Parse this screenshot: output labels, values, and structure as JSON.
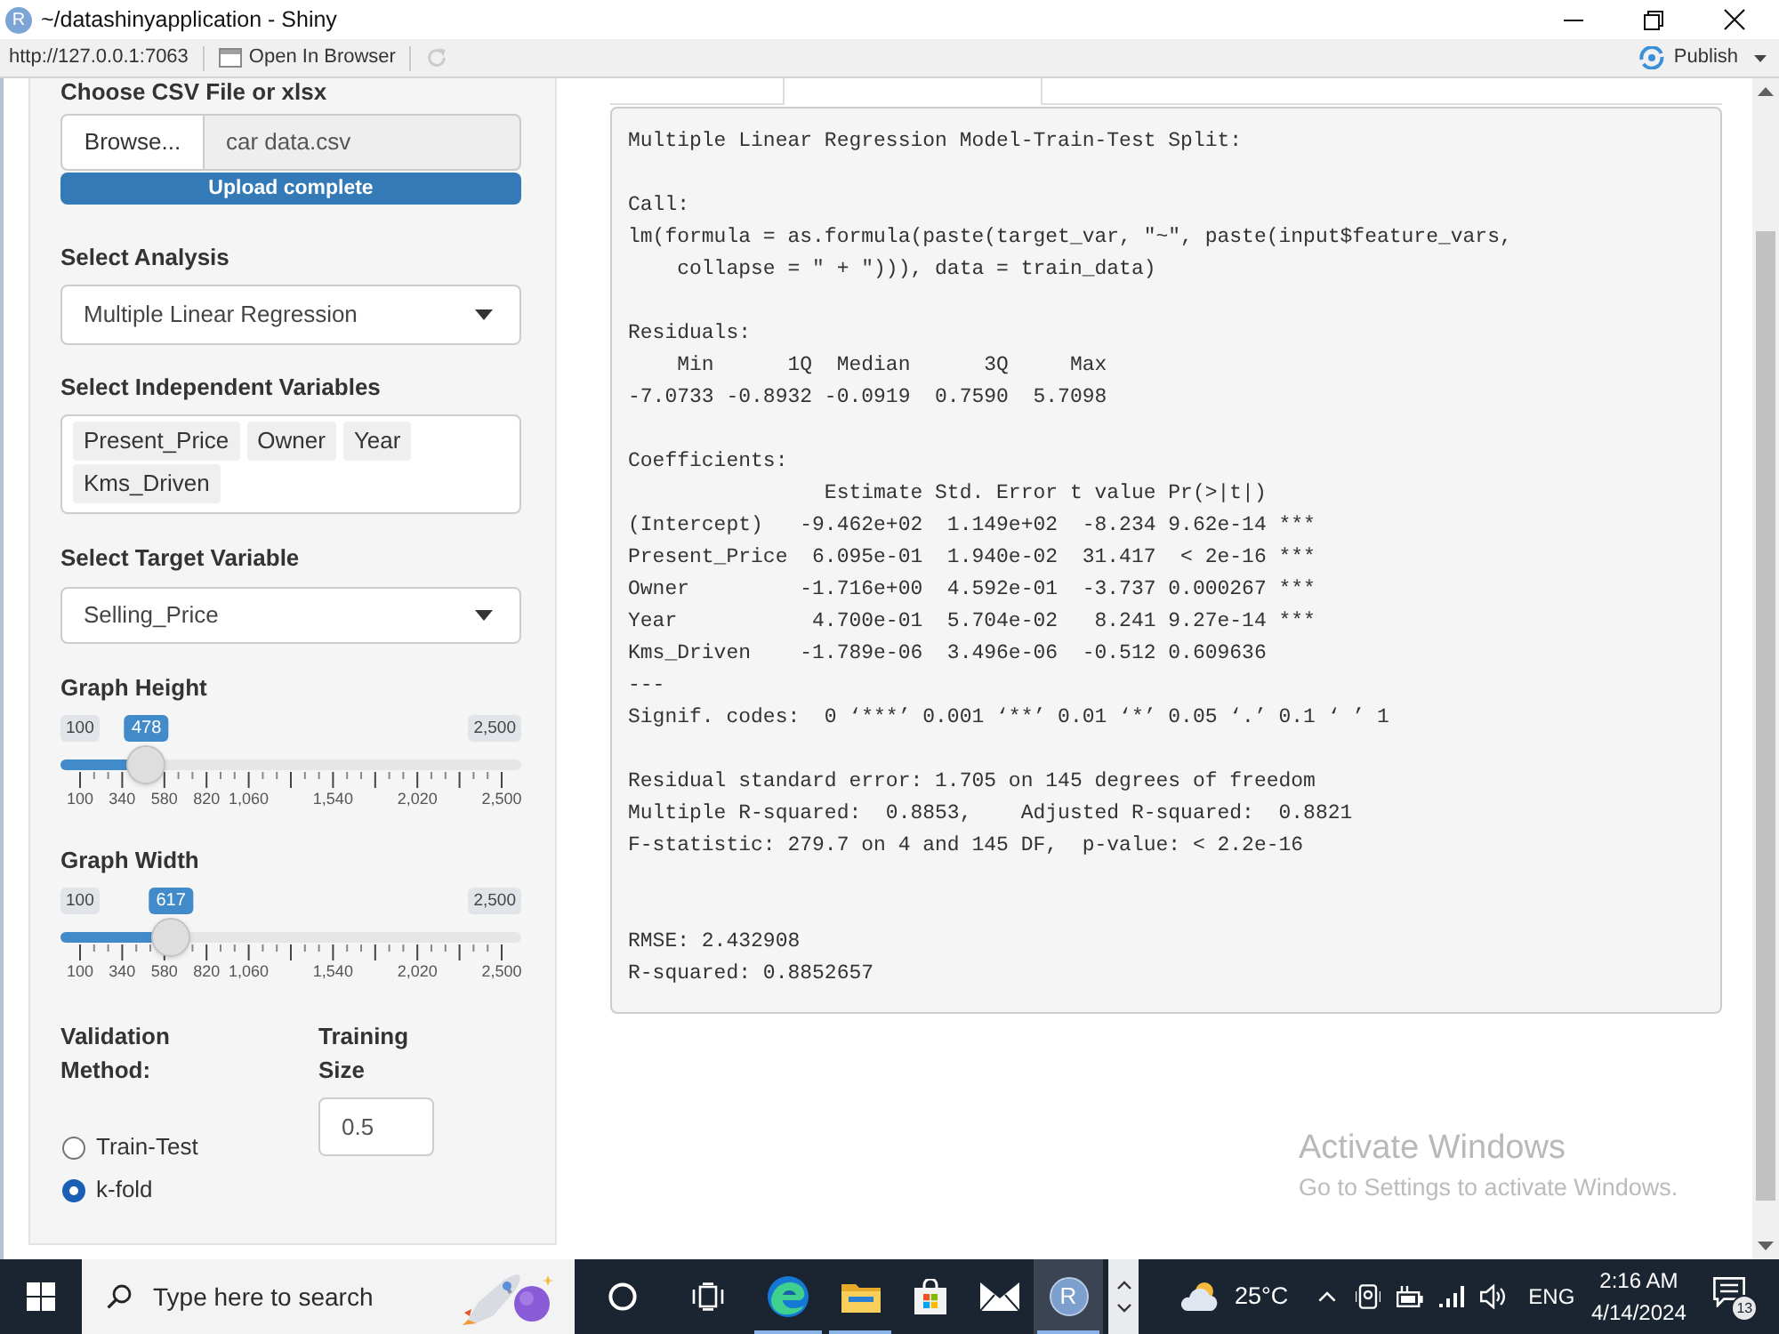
{
  "window": {
    "logo_letter": "R",
    "title": "~/datashinyapplication - Shiny"
  },
  "toolbar": {
    "url": "http://127.0.0.1:7063",
    "open_button": "Open In Browser",
    "publish_button": "Publish"
  },
  "sidebar": {
    "file_input": {
      "label": "Choose CSV File or xlsx",
      "browse_button": "Browse...",
      "file_name": "car data.csv",
      "progress": {
        "text": "Upload complete",
        "level": 1
      }
    },
    "analysis_select": {
      "label": "Select Analysis",
      "value": "Multiple Linear Regression"
    },
    "variables_select": {
      "label": "Select Independent Variables",
      "chips": [
        "Present_Price",
        "Owner",
        "Year",
        "Kms_Driven"
      ]
    },
    "target_select": {
      "label": "Select Target Variable",
      "value": "Selling_Price"
    },
    "sliders": [
      {
        "label": "Graph Height",
        "min": "100",
        "max": "2,500",
        "value": "478",
        "level": 0.1575,
        "grid": [
          "100",
          "340",
          "580",
          "820",
          "1,060",
          "1,540",
          "2,020",
          "2,500"
        ]
      },
      {
        "label": "Graph Width",
        "min": "100",
        "max": "2,500",
        "value": "617",
        "level": 0.2154,
        "grid": [
          "100",
          "340",
          "580",
          "820",
          "1,060",
          "1,540",
          "2,020",
          "2,500"
        ]
      }
    ],
    "validation": {
      "label": "Validation Method:",
      "options": [
        {
          "label": "Train-Test",
          "selected": false
        },
        {
          "label": "k-fold",
          "selected": true
        }
      ]
    },
    "training_size": {
      "label": "Training Size",
      "value": "0.5"
    }
  },
  "output": {
    "blocks": [
      [
        "Multiple Linear Regression Model-Train-Test Split:"
      ],
      [
        "Call:",
        "lm(formula = as.formula(paste(target_var, \"~\", paste(input$feature_vars,",
        "    collapse = \" + \"))), data = train_data)"
      ],
      [
        "Residuals:",
        "    Min      1Q  Median      3Q     Max",
        "-7.0733 -0.8932 -0.0919  0.7590  5.7098"
      ],
      [
        "Coefficients:",
        "                Estimate Std. Error t value Pr(>|t|)",
        "(Intercept)   -9.462e+02  1.149e+02  -8.234 9.62e-14 ***",
        "Present_Price  6.095e-01  1.940e-02  31.417  < 2e-16 ***",
        "Owner         -1.716e+00  4.592e-01  -3.737 0.000267 ***",
        "Year           4.700e-01  5.704e-02   8.241 9.27e-14 ***",
        "Kms_Driven    -1.789e-06  3.496e-06  -0.512 0.609636",
        "---",
        "Signif. codes:  0 ‘***’ 0.001 ‘**’ 0.01 ‘*’ 0.05 ‘.’ 0.1 ‘ ’ 1"
      ],
      [
        "Residual standard error: 1.705 on 145 degrees of freedom",
        "Multiple R-squared:  0.8853,    Adjusted R-squared:  0.8821",
        "F-statistic: 279.7 on 4 and 145 DF,  p-value: < 2.2e-16"
      ]
    ],
    "metrics": [
      "RMSE: 2.432908",
      "R-squared: 0.8852657"
    ]
  },
  "activation_notice": {
    "title": "Activate Windows",
    "subtitle": "Go to Settings to activate Windows."
  },
  "taskbar": {
    "search": {
      "placeholder": "Type here to search"
    },
    "apps": [
      {
        "kind": "cortana",
        "running": false,
        "selected": false
      },
      {
        "kind": "task_view",
        "running": false,
        "selected": false
      },
      {
        "kind": "edge",
        "running": true,
        "selected": false
      },
      {
        "kind": "explorer",
        "running": true,
        "selected": false
      },
      {
        "kind": "store",
        "running": false,
        "selected": false
      },
      {
        "kind": "mail",
        "running": false,
        "selected": false
      },
      {
        "kind": "r",
        "letter": "R",
        "running": true,
        "selected": true
      }
    ],
    "tray": {
      "weather": "25°C",
      "language": "ENG",
      "time": "2:16 AM",
      "date": "4/14/2024",
      "notifications": "13"
    }
  }
}
